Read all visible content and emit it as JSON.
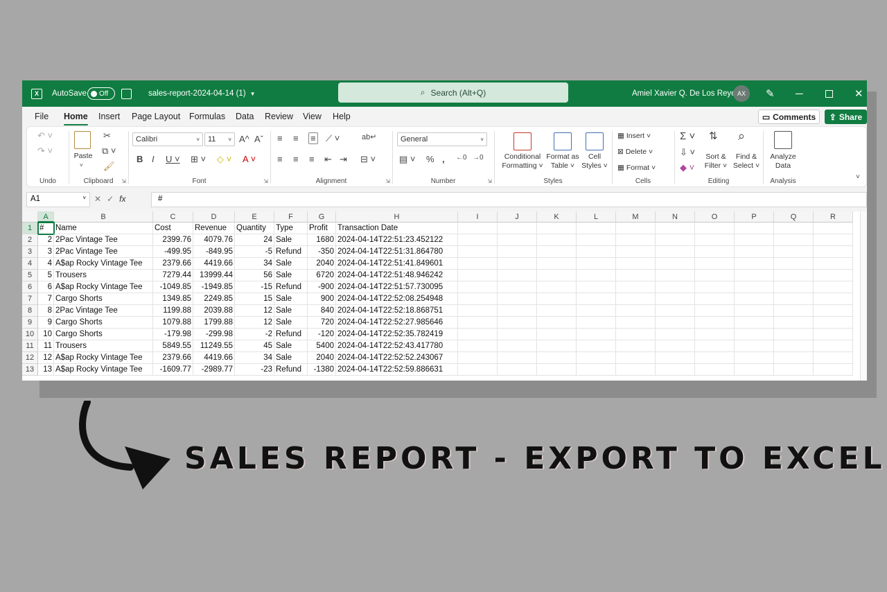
{
  "titlebar": {
    "autosave_label": "AutoSave",
    "autosave_state": "Off",
    "filename": "sales-report-2024-04-14 (1)",
    "search_placeholder": "Search (Alt+Q)",
    "user_name": "Amiel Xavier Q. De Los Reyes",
    "user_initials": "AX",
    "accent": "#107c41"
  },
  "menu": {
    "tabs": [
      "File",
      "Home",
      "Insert",
      "Page Layout",
      "Formulas",
      "Data",
      "Review",
      "View",
      "Help"
    ],
    "active": "Home",
    "comments_label": "Comments",
    "share_label": "Share"
  },
  "ribbon": {
    "undo_group": "Undo",
    "clipboard_group": "Clipboard",
    "paste_label": "Paste",
    "font_group": "Font",
    "font_name": "Calibri",
    "font_size": "11",
    "alignment_group": "Alignment",
    "number_group": "Number",
    "number_format": "General",
    "styles_group": "Styles",
    "conditional_formatting": [
      "Conditional",
      "Formatting"
    ],
    "format_as_table": [
      "Format as",
      "Table"
    ],
    "cell_styles": [
      "Cell",
      "Styles"
    ],
    "cells_group": "Cells",
    "insert_label": "Insert",
    "delete_label": "Delete",
    "format_label": "Format",
    "editing_group": "Editing",
    "sort_filter": [
      "Sort &",
      "Filter"
    ],
    "find_select": [
      "Find &",
      "Select"
    ],
    "analysis_group": "Analysis",
    "analyze_data": [
      "Analyze",
      "Data"
    ]
  },
  "formula_bar": {
    "name_box": "A1",
    "fx": "fx",
    "content": "#"
  },
  "sheet": {
    "columns": [
      "A",
      "B",
      "C",
      "D",
      "E",
      "F",
      "G",
      "H",
      "I",
      "J",
      "K",
      "L",
      "M",
      "N",
      "O",
      "P",
      "Q",
      "R"
    ],
    "rows": [
      "1",
      "2",
      "3",
      "4",
      "5",
      "6",
      "7",
      "8",
      "9",
      "10",
      "11",
      "12",
      "13"
    ],
    "header": [
      "#",
      "Name",
      "Cost",
      "Revenue",
      "Quantity",
      "Type",
      "Profit",
      "Transaction Date"
    ],
    "data": [
      [
        "2",
        "2Pac Vintage Tee",
        "2399.76",
        "4079.76",
        "24",
        "Sale",
        "1680",
        "2024-04-14T22:51:23.452122"
      ],
      [
        "3",
        "2Pac Vintage Tee",
        "-499.95",
        "-849.95",
        "-5",
        "Refund",
        "-350",
        "2024-04-14T22:51:31.864780"
      ],
      [
        "4",
        "A$ap Rocky Vintage Tee",
        "2379.66",
        "4419.66",
        "34",
        "Sale",
        "2040",
        "2024-04-14T22:51:41.849601"
      ],
      [
        "5",
        "Trousers",
        "7279.44",
        "13999.44",
        "56",
        "Sale",
        "6720",
        "2024-04-14T22:51:48.946242"
      ],
      [
        "6",
        "A$ap Rocky Vintage Tee",
        "-1049.85",
        "-1949.85",
        "-15",
        "Refund",
        "-900",
        "2024-04-14T22:51:57.730095"
      ],
      [
        "7",
        "Cargo Shorts",
        "1349.85",
        "2249.85",
        "15",
        "Sale",
        "900",
        "2024-04-14T22:52:08.254948"
      ],
      [
        "8",
        "2Pac Vintage Tee",
        "1199.88",
        "2039.88",
        "12",
        "Sale",
        "840",
        "2024-04-14T22:52:18.868751"
      ],
      [
        "9",
        "Cargo Shorts",
        "1079.88",
        "1799.88",
        "12",
        "Sale",
        "720",
        "2024-04-14T22:52:27.985646"
      ],
      [
        "10",
        "Cargo Shorts",
        "-179.98",
        "-299.98",
        "-2",
        "Refund",
        "-120",
        "2024-04-14T22:52:35.782419"
      ],
      [
        "11",
        "Trousers",
        "5849.55",
        "11249.55",
        "45",
        "Sale",
        "5400",
        "2024-04-14T22:52:43.417780"
      ],
      [
        "12",
        "A$ap Rocky Vintage Tee",
        "2379.66",
        "4419.66",
        "34",
        "Sale",
        "2040",
        "2024-04-14T22:52:52.243067"
      ],
      [
        "13",
        "A$ap Rocky Vintage Tee",
        "-1609.77",
        "-2989.77",
        "-23",
        "Refund",
        "-1380",
        "2024-04-14T22:52:59.886631"
      ]
    ]
  },
  "caption": "SALES REPORT - EXPORT TO EXCEL"
}
